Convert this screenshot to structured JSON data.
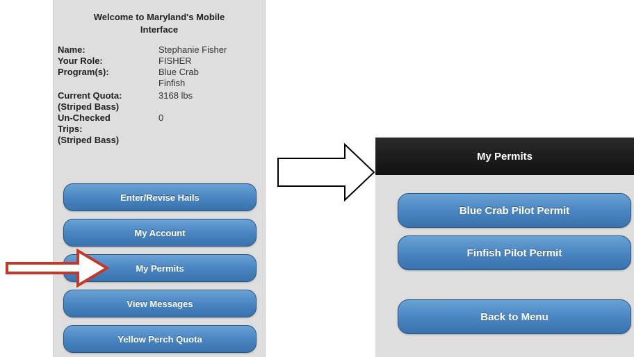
{
  "left_screen": {
    "welcome_line1": "Welcome to Maryland's Mobile",
    "welcome_line2": "Interface",
    "info": {
      "name_label": "Name:",
      "name_value": "Stephanie Fisher",
      "role_label": "Your Role:",
      "role_value": "FISHER",
      "programs_label": "Program(s):",
      "programs_value_1": "Blue Crab",
      "programs_value_2": "Finfish",
      "quota_label_1": "Current Quota:",
      "quota_label_2": "(Striped Bass)",
      "quota_value": "3168 lbs",
      "trips_label_1": "Un-Checked",
      "trips_label_2": "Trips:",
      "trips_label_3": "(Striped Bass)",
      "trips_value": "0"
    },
    "menu": [
      {
        "label": "Enter/Revise Hails"
      },
      {
        "label": "My Account"
      },
      {
        "label": "My Permits"
      },
      {
        "label": "View Messages"
      },
      {
        "label": "Yellow Perch Quota"
      }
    ]
  },
  "right_screen": {
    "title": "My Permits",
    "permits": [
      {
        "label": "Blue Crab Pilot Permit"
      },
      {
        "label": "Finfish Pilot Permit"
      }
    ],
    "back_label": "Back to Menu"
  },
  "colors": {
    "button_blue": "#4a86c2",
    "header_black": "#1a1a1a",
    "panel_gray": "#dedede",
    "highlight_arrow_red": "#c0392b"
  },
  "icons": {
    "transition_arrow": "right-arrow-outline-icon",
    "highlight_arrow": "red-right-arrow-icon"
  }
}
